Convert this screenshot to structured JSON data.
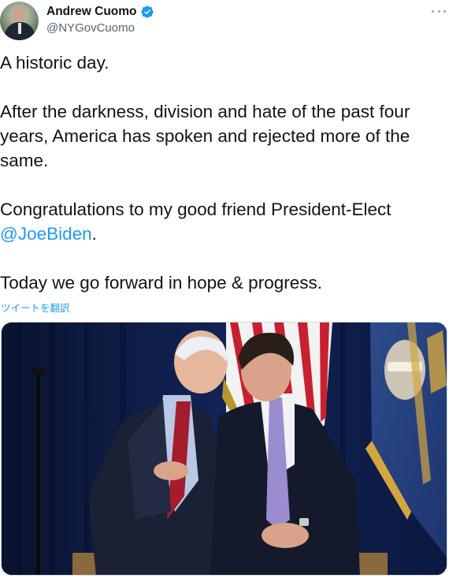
{
  "user": {
    "display_name": "Andrew Cuomo",
    "handle": "@NYGovCuomo",
    "verified": true
  },
  "tweet": {
    "paragraphs": [
      {
        "text": "A historic day."
      },
      {
        "text": "After the darkness, division and hate of the past four years, America has spoken and rejected more of the same."
      },
      {
        "text_before": "Congratulations to my good friend President-Elect ",
        "mention": "@JoeBiden",
        "text_after": "."
      },
      {
        "text": "Today we go forward in hope & progress."
      }
    ],
    "translate_label": "ツイートを翻訳"
  },
  "icons": {
    "verified": "verified-badge-icon",
    "more": "more-options-icon"
  },
  "colors": {
    "link": "#1d9bf0",
    "verified": "#1d9bf0",
    "text": "#0f1419",
    "secondary": "#536471"
  }
}
